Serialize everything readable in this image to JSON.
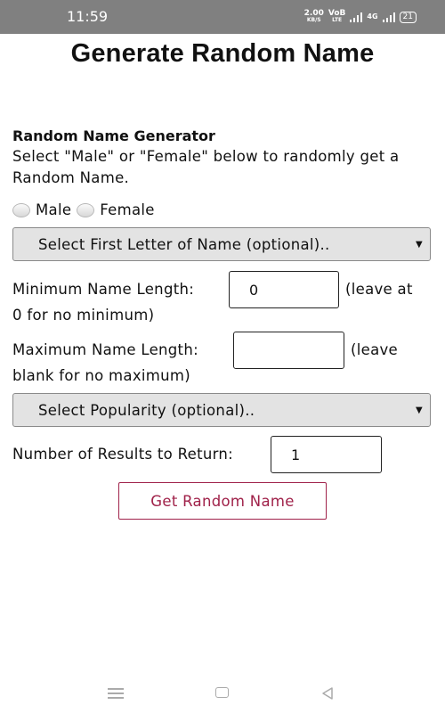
{
  "status_bar": {
    "time": "11:59",
    "speed_value": "2.00",
    "speed_unit": "KB/S",
    "volte_top": "VoB",
    "volte_bottom": "LTE",
    "network": "4G",
    "battery": "21"
  },
  "page": {
    "title": "Generate Random Name"
  },
  "form": {
    "section_title": "Random Name Generator",
    "intro": "Select \"Male\" or \"Female\" below to randomly get a Random Name.",
    "gender_options": [
      "Male",
      "Female"
    ],
    "first_letter_select": "Select First Letter of Name (optional)..",
    "min_length_label": "Minimum Name Length:",
    "min_length_value": "0",
    "min_length_hint_1": "(leave at",
    "min_length_hint_2": "0 for no minimum)",
    "max_length_label": "Maximum Name Length:",
    "max_length_value": "",
    "max_length_hint_1": "(leave",
    "max_length_hint_2": "blank for no maximum)",
    "popularity_select": "Select Popularity (optional)..",
    "results_label": "Number of Results to Return:",
    "results_value": "1",
    "submit_label": "Get Random Name"
  },
  "colors": {
    "status_bar_bg": "#808080",
    "button_accent": "#a0224a",
    "select_bg": "#e3e3e3"
  },
  "icons": {
    "nav_menu": "menu-icon",
    "nav_home": "home-icon",
    "nav_back": "back-icon"
  }
}
